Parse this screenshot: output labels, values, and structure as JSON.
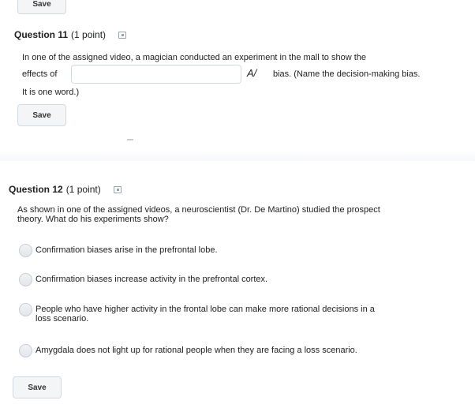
{
  "top_save": {
    "label": "Save"
  },
  "q11": {
    "number": "Question 11",
    "points": "(1 point)",
    "line1": "In one of the assigned video, a magician conducted an experiment in the mall to show the",
    "line2_pre": "effects of",
    "line2_post": "bias. (Name the decision-making bias.",
    "line3": "It is one word.)",
    "answer": "",
    "spellcheck_icon": "spellcheck-icon",
    "save": "Save"
  },
  "q12": {
    "number": "Question 12",
    "points": "(1 point)",
    "prompt_line1": "As shown in one of the assigned videos, a neuroscientist (Dr. De Martino) studied the prospect",
    "prompt_line2": "theory. What do his experiments show?",
    "options": [
      {
        "line1": "Confirmation biases arise in the prefrontal lobe.",
        "line2": ""
      },
      {
        "line1": "Confirmation biases increase activity in the prefrontal cortex.",
        "line2": ""
      },
      {
        "line1": "People who have higher activity in the frontal lobe can make more rational decisions in a",
        "line2": "loss scenario."
      },
      {
        "line1": "Amygdala does not light up for rational people when they are facing a loss scenario.",
        "line2": ""
      }
    ],
    "save": "Save"
  }
}
